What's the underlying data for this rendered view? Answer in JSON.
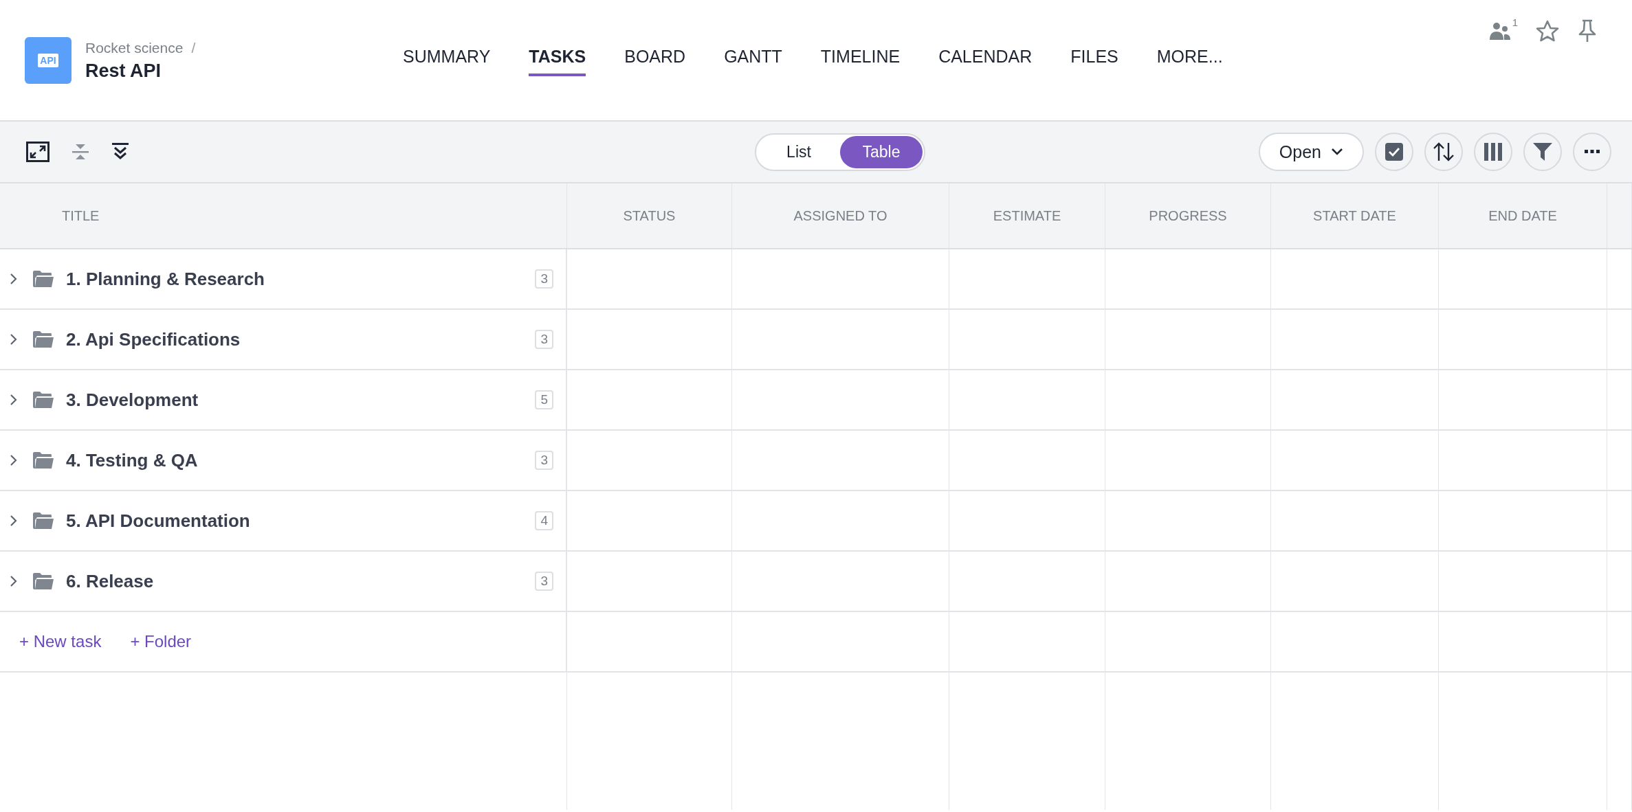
{
  "project": {
    "parent": "Rocket science",
    "separator": "/",
    "name": "Rest API",
    "logo_text": "API"
  },
  "nav": [
    {
      "label": "SUMMARY",
      "selected": false
    },
    {
      "label": "TASKS",
      "selected": true
    },
    {
      "label": "BOARD",
      "selected": false
    },
    {
      "label": "GANTT",
      "selected": false
    },
    {
      "label": "TIMELINE",
      "selected": false
    },
    {
      "label": "CALENDAR",
      "selected": false
    },
    {
      "label": "FILES",
      "selected": false
    },
    {
      "label": "MORE...",
      "selected": false
    }
  ],
  "members_count": "1",
  "view_toggle": [
    {
      "label": "List",
      "selected": false
    },
    {
      "label": "Table",
      "selected": true
    }
  ],
  "status_filter": "Open",
  "table": {
    "columns": [
      "TITLE",
      "STATUS",
      "ASSIGNED TO",
      "ESTIMATE",
      "PROGRESS",
      "START DATE",
      "END DATE"
    ],
    "rows": [
      {
        "title": "1. Planning & Research",
        "count": "3",
        "expanded": false
      },
      {
        "title": "2. Api Specifications",
        "count": "3",
        "expanded": false
      },
      {
        "title": "3. Development",
        "count": "5",
        "expanded": false
      },
      {
        "title": "4. Testing & QA",
        "count": "3",
        "expanded": false
      },
      {
        "title": "5. API Documentation",
        "count": "4",
        "expanded": false
      },
      {
        "title": "6. Release",
        "count": "3",
        "expanded": false
      }
    ],
    "add_links": [
      "+ New task",
      "+ Folder"
    ]
  }
}
